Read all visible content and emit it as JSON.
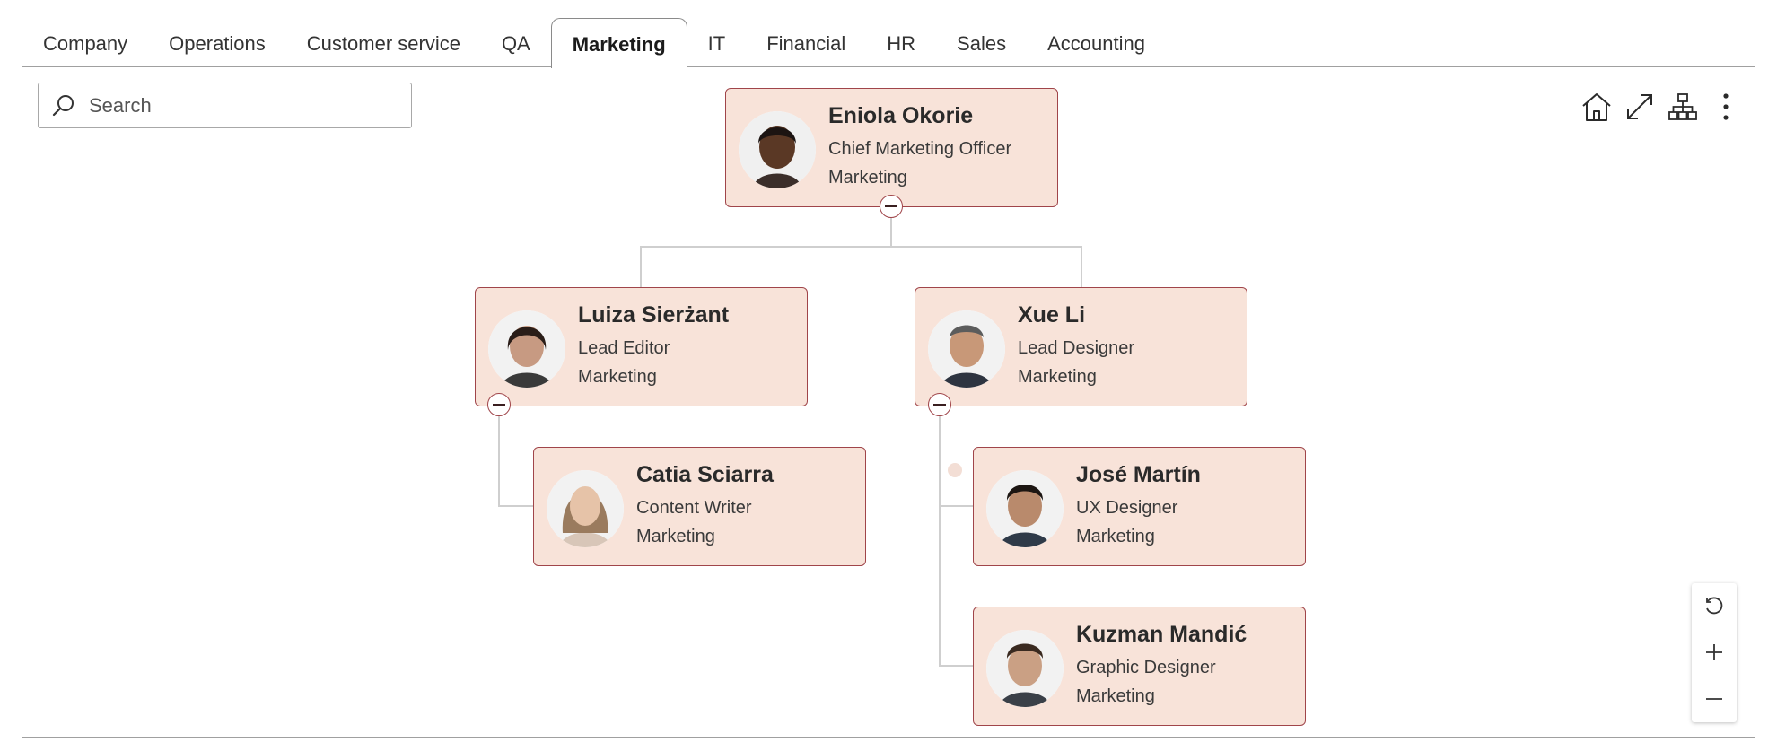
{
  "tabs": [
    {
      "label": "Company"
    },
    {
      "label": "Operations"
    },
    {
      "label": "Customer service"
    },
    {
      "label": "QA"
    },
    {
      "label": "Marketing",
      "active": true
    },
    {
      "label": "IT"
    },
    {
      "label": "Financial"
    },
    {
      "label": "HR"
    },
    {
      "label": "Sales"
    },
    {
      "label": "Accounting"
    }
  ],
  "search": {
    "placeholder": "Search",
    "value": ""
  },
  "toolbar": {
    "home_icon": "home-icon",
    "expand_icon": "expand-icon",
    "hierarchy_icon": "org-chart-icon",
    "more_icon": "more-vertical-icon"
  },
  "colors": {
    "node_fill": "#f8e3d9",
    "node_border": "#a0454a",
    "connector": "#cfcfcf"
  },
  "org": {
    "root": {
      "name": "Eniola Okorie",
      "title": "Chief Marketing Officer",
      "department": "Marketing"
    },
    "luiza": {
      "name": "Luiza Sierżant",
      "title": "Lead Editor",
      "department": "Marketing"
    },
    "xue": {
      "name": "Xue Li",
      "title": "Lead Designer",
      "department": "Marketing"
    },
    "catia": {
      "name": "Catia Sciarra",
      "title": "Content Writer",
      "department": "Marketing"
    },
    "jose": {
      "name": "José Martín",
      "title": "UX Designer",
      "department": "Marketing"
    },
    "kuzman": {
      "name": "Kuzman Mandić",
      "title": "Graphic Designer",
      "department": "Marketing"
    }
  },
  "zoom_controls": {
    "reset_icon": "reset-icon",
    "zoom_in_icon": "plus-icon",
    "zoom_out_icon": "minus-icon"
  }
}
